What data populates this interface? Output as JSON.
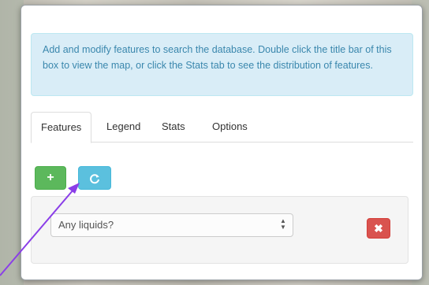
{
  "info_text": "Add and modify features to search the database. Double click the title bar of this box to view the map, or click the Stats tab to see the distribution of features.",
  "tabs": [
    {
      "label": "Features",
      "active": true
    },
    {
      "label": "Legend",
      "active": false
    },
    {
      "label": "Stats",
      "active": false
    },
    {
      "label": "Options",
      "active": false
    }
  ],
  "toolbar": {
    "add_icon": "+",
    "refresh_icon": "refresh-icon"
  },
  "feature_row": {
    "select_value": "Any liquids?",
    "remove_icon": "✖"
  },
  "colors": {
    "info_bg": "#d9edf7",
    "info_text": "#3a87ad",
    "add_button": "#5cb85c",
    "refresh_button": "#5bc0de",
    "remove_button": "#d9534f",
    "annotation_arrow": "#8a3ee8"
  }
}
